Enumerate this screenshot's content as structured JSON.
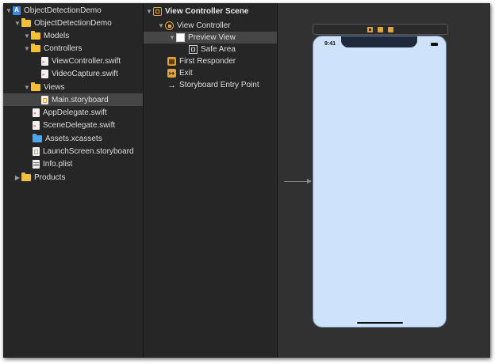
{
  "navigator": {
    "items": [
      {
        "label": "ObjectDetectionDemo",
        "icon": "xcode-project-icon",
        "disclosure": "expanded"
      },
      {
        "label": "ObjectDetectionDemo",
        "icon": "folder-icon",
        "disclosure": "expanded"
      },
      {
        "label": "Models",
        "icon": "folder-icon",
        "disclosure": "expanded"
      },
      {
        "label": "Controllers",
        "icon": "folder-icon",
        "disclosure": "expanded"
      },
      {
        "label": "ViewController.swift",
        "icon": "swift-file-icon"
      },
      {
        "label": "VideoCapture.swift",
        "icon": "swift-file-icon"
      },
      {
        "label": "Views",
        "icon": "folder-icon",
        "disclosure": "expanded"
      },
      {
        "label": "Main.storyboard",
        "icon": "storyboard-file-icon",
        "selected": true
      },
      {
        "label": "AppDelegate.swift",
        "icon": "swift-file-icon"
      },
      {
        "label": "SceneDelegate.swift",
        "icon": "swift-file-icon"
      },
      {
        "label": "Assets.xcassets",
        "icon": "asset-catalog-icon"
      },
      {
        "label": "LaunchScreen.storyboard",
        "icon": "storyboard-file-icon"
      },
      {
        "label": "Info.plist",
        "icon": "plist-file-icon"
      },
      {
        "label": "Products",
        "icon": "folder-icon",
        "disclosure": "collapsed"
      }
    ]
  },
  "outline": {
    "items": [
      {
        "label": "View Controller Scene",
        "icon": "scene-icon"
      },
      {
        "label": "View Controller",
        "icon": "view-controller-icon"
      },
      {
        "label": "Preview View",
        "icon": "view-icon",
        "selected": true
      },
      {
        "label": "Safe Area",
        "icon": "safe-area-icon"
      },
      {
        "label": "First Responder",
        "icon": "first-responder-icon"
      },
      {
        "label": "Exit",
        "icon": "exit-icon"
      },
      {
        "label": "Storyboard Entry Point",
        "icon": "entry-point-arrow-icon"
      }
    ]
  },
  "canvas": {
    "status_time": "9:41",
    "device_color": "#cfe2fb",
    "accent_color": "#e0a340"
  }
}
